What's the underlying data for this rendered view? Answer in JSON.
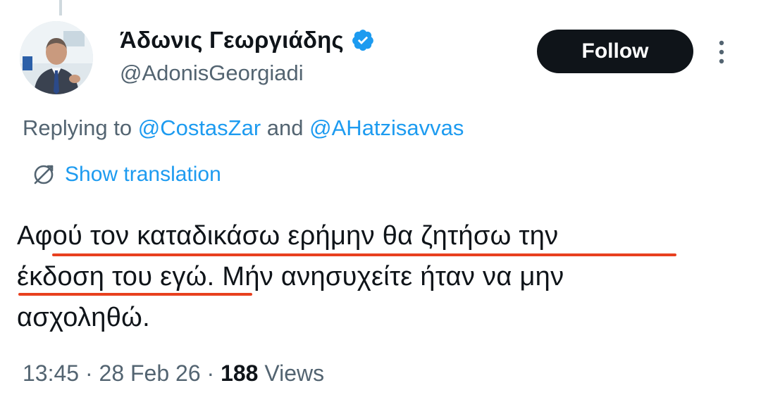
{
  "tweet": {
    "author": {
      "display_name": "Άδωνις Γεωργιάδης",
      "handle": "@AdonisGeorgiadi",
      "verified": true
    },
    "follow_label": "Follow",
    "replying_prefix": "Replying to",
    "replying_to": [
      "@CostasZar",
      "@AHatzisavvas"
    ],
    "replying_conjunction": "and",
    "show_translation_label": "Show translation",
    "text_lines": [
      "Αφού τον καταδικάσω ερήμην θα ζητήσω την",
      "έκδοση του εγώ. Μήν ανησυχείτε ήταν να μην",
      "ασχοληθώ."
    ],
    "time": "13:45",
    "date": "28 Feb 26",
    "separator": "·",
    "views_count": "188",
    "views_label": "Views"
  },
  "colors": {
    "accent": "#1d9bf0",
    "muted": "#536471",
    "text": "#0f1419",
    "follow_bg": "#0f1419",
    "highlight_underline": "#e8401f",
    "verified_badge": "#1d9bf0"
  },
  "icons": {
    "verified": "verified-badge-icon",
    "more": "more-vertical-icon",
    "translate": "translate-globe-icon"
  }
}
